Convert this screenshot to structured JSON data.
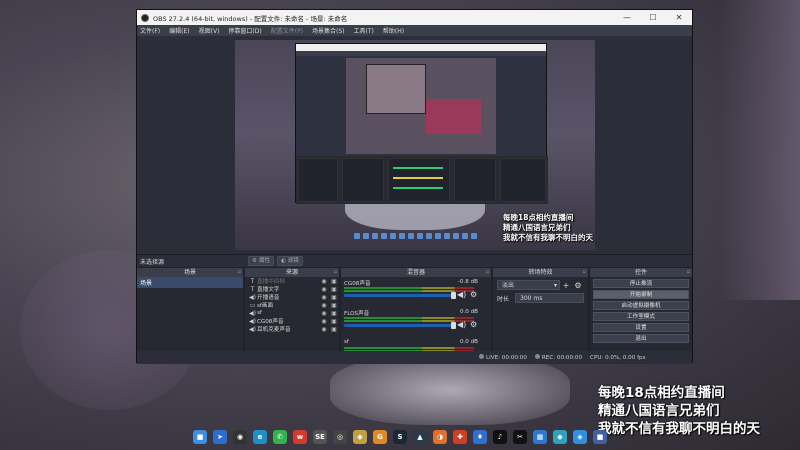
{
  "window": {
    "title": "OBS 27.2.4 (64-bit, windows) - 配置文件: 未命名 - 场景: 未命名",
    "controls": {
      "minimize": "—",
      "maximize": "☐",
      "close": "✕"
    }
  },
  "menu": [
    {
      "label": "文件(F)",
      "enabled": true
    },
    {
      "label": "编辑(E)",
      "enabled": true
    },
    {
      "label": "视图(V)",
      "enabled": true
    },
    {
      "label": "停靠窗口(D)",
      "enabled": true
    },
    {
      "label": "配置文件(P)",
      "enabled": false
    },
    {
      "label": "场景集合(S)",
      "enabled": true
    },
    {
      "label": "工具(T)",
      "enabled": true
    },
    {
      "label": "帮助(H)",
      "enabled": true
    }
  ],
  "overlay_small": [
    "每晚18点相约直播间",
    "精通八国语言兄弟们",
    "我就不信有我聊不明白的天"
  ],
  "overlay_big": [
    "每晚18点相约直播间",
    "精通八国语言兄弟们",
    "我就不信有我聊不明白的天"
  ],
  "source_toolbar": {
    "no_selection": "未选择源",
    "properties": "属性",
    "filters": "滤镜"
  },
  "scenes": {
    "header": "场景",
    "items": [
      "场景"
    ]
  },
  "sources": {
    "header": "来源",
    "items": [
      {
        "icon": "T",
        "label": "直播中间挡",
        "dim": true
      },
      {
        "icon": "T",
        "label": "直播文字",
        "dim": false
      },
      {
        "icon": "◀)",
        "label": "开播语音",
        "dim": false
      },
      {
        "icon": "▭",
        "label": "sf画面",
        "dim": false
      },
      {
        "icon": "◀)",
        "label": "sf",
        "dim": false
      },
      {
        "icon": "◀)",
        "label": "CG08声音",
        "dim": false
      },
      {
        "icon": "◀)",
        "label": "耳机克麦声音",
        "dim": false
      }
    ]
  },
  "mixer": {
    "header": "混音器",
    "channels": [
      {
        "name": "CG08声音",
        "db": "-0.8 dB",
        "level": 0.78
      },
      {
        "name": "FLOS声音",
        "db": "0.0 dB",
        "level": 0.78
      },
      {
        "name": "sf",
        "db": "0.0 dB",
        "level": 0.78
      }
    ]
  },
  "transitions": {
    "header": "转场特效",
    "selected": "淡出",
    "duration_label": "时长",
    "duration_value": "300 ms"
  },
  "controls": {
    "header": "控件",
    "buttons": [
      {
        "label": "停止推流",
        "active": false
      },
      {
        "label": "开始录制",
        "active": true
      },
      {
        "label": "启动虚拟摄像机",
        "active": false
      },
      {
        "label": "工作室模式",
        "active": false
      },
      {
        "label": "设置",
        "active": false
      },
      {
        "label": "退出",
        "active": false
      }
    ]
  },
  "status": {
    "live": "LIVE: 00:00:00",
    "rec": "REC: 00:00:00",
    "cpu": "CPU: 0.0%, 0.00 fps"
  },
  "taskbar": [
    {
      "name": "windows-start-icon",
      "glyph": "■",
      "color": "#3a8ee6"
    },
    {
      "name": "arrow-app-icon",
      "glyph": "➤",
      "color": "#2a6fd0"
    },
    {
      "name": "obs-app-icon",
      "glyph": "◉",
      "color": "#333333"
    },
    {
      "name": "edge-icon",
      "glyph": "e",
      "color": "#1f8fc8"
    },
    {
      "name": "wechat-icon",
      "glyph": "✆",
      "color": "#2fb34a"
    },
    {
      "name": "weibo-icon",
      "glyph": "w",
      "color": "#d8392f"
    },
    {
      "name": "se-app-icon",
      "glyph": "SE",
      "color": "#555555"
    },
    {
      "name": "app-icon-1",
      "glyph": "◎",
      "color": "#444444"
    },
    {
      "name": "app-icon-2",
      "glyph": "◆",
      "color": "#c0a040"
    },
    {
      "name": "app-icon-3",
      "glyph": "G",
      "color": "#e08a20"
    },
    {
      "name": "steam-icon",
      "glyph": "S",
      "color": "#1b2838"
    },
    {
      "name": "app-icon-4",
      "glyph": "▲",
      "color": "#2a3a4a"
    },
    {
      "name": "app-icon-5",
      "glyph": "◑",
      "color": "#e07030"
    },
    {
      "name": "app-icon-6",
      "glyph": "✚",
      "color": "#d04020"
    },
    {
      "name": "app-icon-7",
      "glyph": "♦",
      "color": "#3070d0"
    },
    {
      "name": "tiktok-icon",
      "glyph": "♪",
      "color": "#111111"
    },
    {
      "name": "capcut-icon",
      "glyph": "✂",
      "color": "#111111"
    },
    {
      "name": "app-icon-8",
      "glyph": "▦",
      "color": "#2a7ad0"
    },
    {
      "name": "app-icon-9",
      "glyph": "◆",
      "color": "#30a0c0"
    },
    {
      "name": "app-icon-10",
      "glyph": "◈",
      "color": "#3090e0"
    },
    {
      "name": "app-icon-11",
      "glyph": "■",
      "color": "#4060a0"
    }
  ]
}
